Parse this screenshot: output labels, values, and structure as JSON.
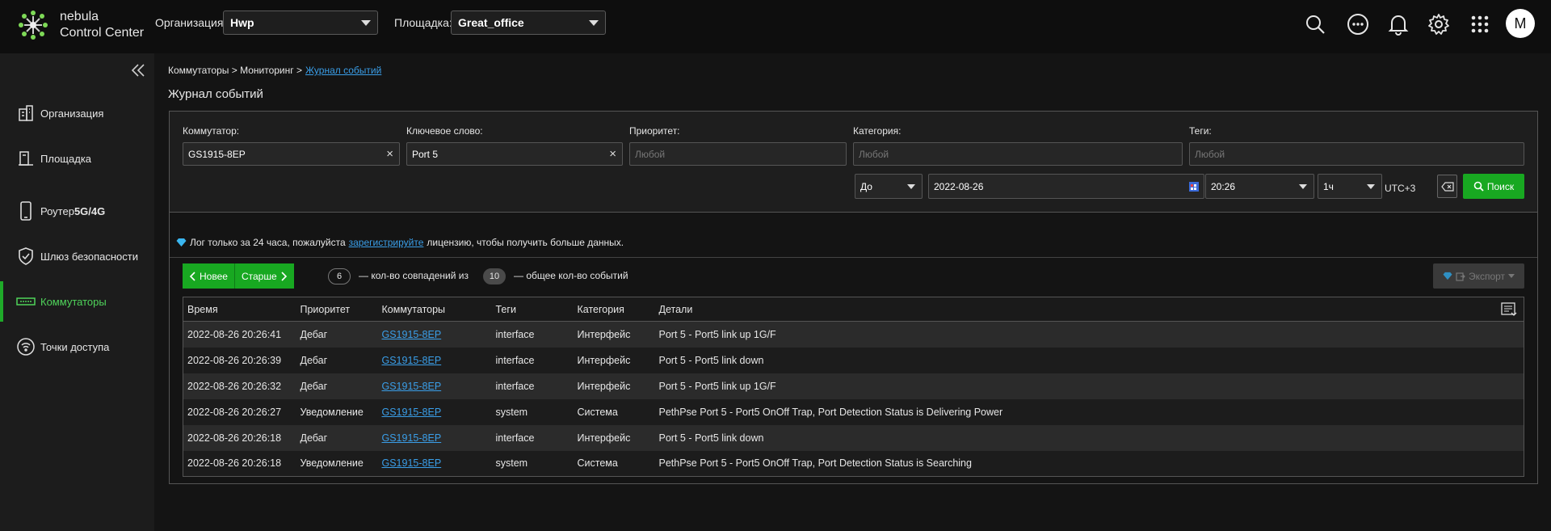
{
  "brand": {
    "line1": "nebula",
    "line2": "Control Center"
  },
  "header": {
    "org_label": "Организация:",
    "org_value": "Hwp",
    "site_label": "Площадка:",
    "site_value": "Great_office",
    "avatar": "M"
  },
  "sidebar": {
    "items": [
      {
        "label": "Организация",
        "icon": "building-icon"
      },
      {
        "label": "Площадка",
        "icon": "site-icon"
      },
      {
        "label": "Роутер ",
        "label_bold": "5G/4G",
        "icon": "phone-icon"
      },
      {
        "label": "Шлюз безопасности",
        "icon": "shield-icon"
      },
      {
        "label": "Коммутаторы",
        "icon": "switch-icon",
        "active": true
      },
      {
        "label": "Точки доступа",
        "icon": "wifi-icon"
      }
    ]
  },
  "breadcrumb": {
    "part1": "Коммутаторы > Мониторинг >",
    "current": "Журнал событий"
  },
  "page_title": "Журнал событий",
  "filters": {
    "switch_label": "Коммутатор:",
    "switch_value": "GS1915-8EP",
    "keyword_label": "Ключевое слово:",
    "keyword_value": "Port 5",
    "priority_label": "Приоритет:",
    "priority_placeholder": "Любой",
    "category_label": "Категория:",
    "category_placeholder": "Любой",
    "tags_label": "Теги:",
    "tags_placeholder": "Любой",
    "mode_value": "До",
    "date_value": "2022-08-26",
    "time_value": "20:26",
    "range_value": "1ч",
    "tz": "UTC+3",
    "search_label": "Поиск",
    "clear_x": "×"
  },
  "notice": {
    "before": "Лог только за 24 часа, пожалуйста",
    "link": "зарегистрируйте",
    "after": "лицензию, чтобы получить больше данных."
  },
  "results": {
    "newer_label": "Новее",
    "older_label": "Старше",
    "matches": "6",
    "matches_text": "— кол-во совпадений из",
    "total": "10",
    "total_text": "— общее кол-во событий",
    "export_label": "Экспорт"
  },
  "table": {
    "columns": [
      "Время",
      "Приоритет",
      "Коммутаторы",
      "Теги",
      "Категория",
      "Детали"
    ],
    "rows": [
      [
        "2022-08-26 20:26:41",
        "Дебаг",
        "GS1915-8EP",
        "interface",
        "Интерфейс",
        "Port 5 - Port5 link up 1G/F"
      ],
      [
        "2022-08-26 20:26:39",
        "Дебаг",
        "GS1915-8EP",
        "interface",
        "Интерфейс",
        "Port 5 - Port5 link down"
      ],
      [
        "2022-08-26 20:26:32",
        "Дебаг",
        "GS1915-8EP",
        "interface",
        "Интерфейс",
        "Port 5 - Port5 link up 1G/F"
      ],
      [
        "2022-08-26 20:26:27",
        "Уведомление",
        "GS1915-8EP",
        "system",
        "Система",
        "PethPse Port 5 - Port5 OnOff Trap, Port Detection Status is Delivering Power"
      ],
      [
        "2022-08-26 20:26:18",
        "Дебаг",
        "GS1915-8EP",
        "interface",
        "Интерфейс",
        "Port 5 - Port5 link down"
      ],
      [
        "2022-08-26 20:26:18",
        "Уведомление",
        "GS1915-8EP",
        "system",
        "Система",
        "PethPse Port 5 - Port5 OnOff Trap, Port Detection Status is Searching"
      ]
    ]
  },
  "colors": {
    "accent": "#18a821",
    "link": "#3a9ee8",
    "bg": "#141414"
  }
}
